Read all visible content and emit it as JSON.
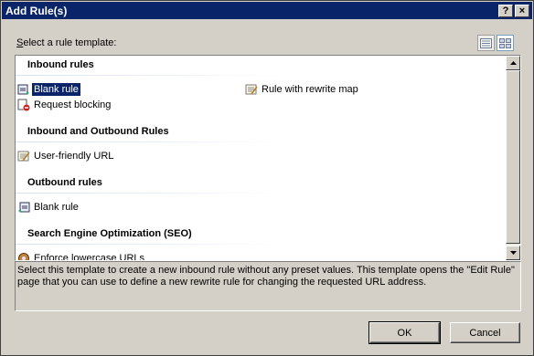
{
  "window": {
    "title": "Add Rule(s)",
    "help_glyph": "?",
    "close_glyph": "×"
  },
  "prompt": {
    "accel": "S",
    "rest": "elect a rule template:"
  },
  "view_buttons": [
    {
      "name": "details-view-icon"
    },
    {
      "name": "tiles-view-icon"
    }
  ],
  "groups": [
    {
      "header": "Inbound rules",
      "items": [
        {
          "label": "Blank rule",
          "icon": "blank-rule-icon",
          "selected": true
        },
        {
          "label": "Request blocking",
          "icon": "request-blocking-icon"
        },
        {
          "label": "Rule with rewrite map",
          "icon": "rewrite-map-icon"
        }
      ]
    },
    {
      "header": "Inbound and Outbound Rules",
      "items": [
        {
          "label": "User-friendly URL",
          "icon": "user-friendly-url-icon"
        }
      ]
    },
    {
      "header": "Outbound rules",
      "items": [
        {
          "label": "Blank rule",
          "icon": "outbound-blank-rule-icon"
        }
      ]
    },
    {
      "header": "Search Engine Optimization (SEO)",
      "items": [
        {
          "label": "Enforce lowercase URLs",
          "icon": "lowercase-url-icon"
        }
      ]
    }
  ],
  "description": "Select this template to create a new inbound rule without any preset values. This template opens the \"Edit Rule\" page that you can use to define a new rewrite rule for changing the requested URL address.",
  "buttons": {
    "ok": "OK",
    "cancel": "Cancel"
  },
  "colors": {
    "titlebar": "#0a246a",
    "selection": "#0a246a",
    "face": "#d4d0c8"
  }
}
